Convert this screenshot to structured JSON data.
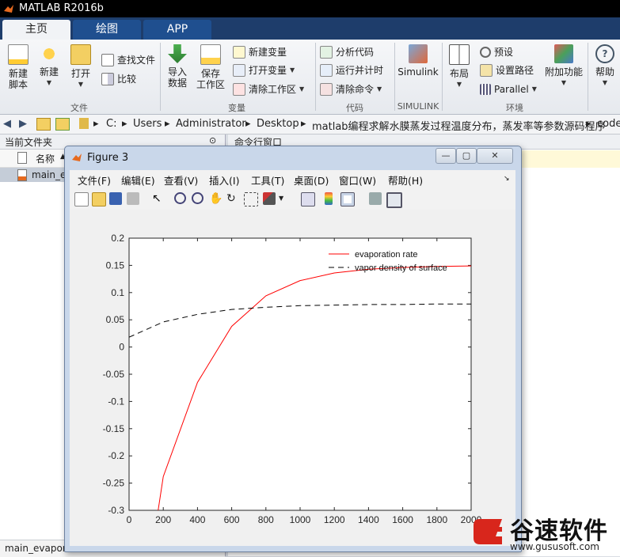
{
  "app_title": "MATLAB R2016b",
  "tabs": [
    "主页",
    "绘图",
    "APP"
  ],
  "ribbon": {
    "file": {
      "new_script": [
        "新建",
        "脚本"
      ],
      "new": "新建",
      "open": "打开",
      "find_files": "查找文件",
      "compare": "比较",
      "group": "文件"
    },
    "variable": {
      "import": [
        "导入",
        "数据"
      ],
      "save_ws": [
        "保存",
        "工作区"
      ],
      "new_var": "新建变量",
      "open_var": "打开变量",
      "clear_ws": "清除工作区",
      "group": "变量"
    },
    "code": {
      "analyze": "分析代码",
      "run_time": "运行并计时",
      "clear_cmd": "清除命令",
      "group": "代码"
    },
    "simulink": {
      "label": "Simulink",
      "group": "SIMULINK"
    },
    "env": {
      "layout": "布局",
      "prefs": "预设",
      "set_path": "设置路径",
      "parallel": "Parallel",
      "addons": "附加功能",
      "group": "环境"
    },
    "help": "帮助"
  },
  "address": [
    "C:",
    "Users",
    "Administrator",
    "Desktop",
    "matlab编程求解水膜蒸发过程温度分布，蒸发率等参数源码程序",
    "code"
  ],
  "left_panel": {
    "title": "当前文件夹",
    "col_name": "名称",
    "file": "main_e",
    "footer": "main_evapora"
  },
  "cmd_panel": {
    "title": "命令行窗口"
  },
  "figure": {
    "title": "Figure 3",
    "menus": [
      "文件(F)",
      "编辑(E)",
      "查看(V)",
      "插入(I)",
      "工具(T)",
      "桌面(D)",
      "窗口(W)",
      "帮助(H)"
    ]
  },
  "chart_data": {
    "type": "line",
    "xlim": [
      0,
      2000
    ],
    "ylim": [
      -0.3,
      0.2
    ],
    "x_ticks": [
      "0",
      "200",
      "400",
      "600",
      "800",
      "1000",
      "1200",
      "1400",
      "1600",
      "1800",
      "2000"
    ],
    "y_ticks": [
      "0.2",
      "0.15",
      "0.1",
      "0.05",
      "0",
      "-0.05",
      "-0.1",
      "-0.15",
      "-0.2",
      "-0.25",
      "-0.3"
    ],
    "legend_position": "top-right",
    "series": [
      {
        "name": "evaporation rate",
        "color": "#ff0000",
        "style": "solid",
        "x": [
          170,
          200,
          400,
          600,
          800,
          1000,
          1200,
          1400,
          1600,
          1800,
          2000
        ],
        "y": [
          -0.3,
          -0.238,
          -0.065,
          0.038,
          0.094,
          0.122,
          0.136,
          0.143,
          0.146,
          0.148,
          0.149
        ]
      },
      {
        "name": "vapor density of surface",
        "color": "#000000",
        "style": "dashed",
        "x": [
          0,
          200,
          400,
          600,
          800,
          1000,
          1200,
          1400,
          1600,
          1800,
          2000
        ],
        "y": [
          0.018,
          0.046,
          0.06,
          0.069,
          0.073,
          0.076,
          0.077,
          0.078,
          0.078,
          0.079,
          0.079
        ]
      }
    ]
  },
  "watermark": {
    "brand": "谷速软件",
    "url": "www.gususoft.com"
  }
}
